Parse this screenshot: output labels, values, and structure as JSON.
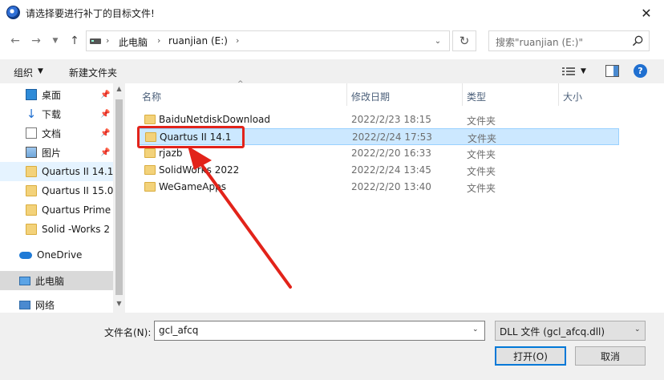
{
  "window": {
    "title": "请选择要进行补丁的目标文件!",
    "close_glyph": "✕"
  },
  "address": {
    "crumbs": [
      "此电脑",
      "ruanjian (E:)"
    ],
    "separator": "›",
    "search_placeholder": "搜索\"ruanjian (E:)\""
  },
  "toolbar": {
    "organize_label": "组织",
    "new_folder_label": "新建文件夹",
    "help_label": "?"
  },
  "nav": {
    "items": [
      {
        "label": "桌面",
        "icon": "desktop-icon",
        "pinned": true
      },
      {
        "label": "下载",
        "icon": "download-icon",
        "pinned": true
      },
      {
        "label": "文档",
        "icon": "document-icon",
        "pinned": true
      },
      {
        "label": "图片",
        "icon": "picture-icon",
        "pinned": true
      },
      {
        "label": "Quartus II 14.1",
        "icon": "folder-icon",
        "selected": true
      },
      {
        "label": "Quartus II 15.0",
        "icon": "folder-icon"
      },
      {
        "label": "Quartus Prime",
        "icon": "folder-icon"
      },
      {
        "label": "Solid -Works 2",
        "icon": "folder-icon"
      },
      {
        "label": "OneDrive",
        "icon": "cloud-icon"
      },
      {
        "label": "此电脑",
        "icon": "computer-icon",
        "highlighted": true
      },
      {
        "label": "网络",
        "icon": "network-icon"
      }
    ]
  },
  "files": {
    "columns": [
      "名称",
      "修改日期",
      "类型",
      "大小"
    ],
    "rows": [
      {
        "name": "BaiduNetdiskDownload",
        "date": "2022/2/23 18:15",
        "type": "文件夹"
      },
      {
        "name": "Quartus II 14.1",
        "date": "2022/2/24 17:53",
        "type": "文件夹",
        "selected": true
      },
      {
        "name": "rjazb",
        "date": "2022/2/20 16:33",
        "type": "文件夹"
      },
      {
        "name": "SolidWorks 2022",
        "date": "2022/2/24 13:45",
        "type": "文件夹"
      },
      {
        "name": "WeGameApps",
        "date": "2022/2/20 13:40",
        "type": "文件夹"
      }
    ]
  },
  "bottom": {
    "filename_label": "文件名(N):",
    "filename_value": "gcl_afcq",
    "filetype_value": "DLL 文件 (gcl_afcq.dll)",
    "open_label": "打开(O)",
    "cancel_label": "取消"
  },
  "colors": {
    "annotation_red": "#e2231a",
    "selection_blue": "#cce8ff",
    "accent": "#0078d7"
  }
}
